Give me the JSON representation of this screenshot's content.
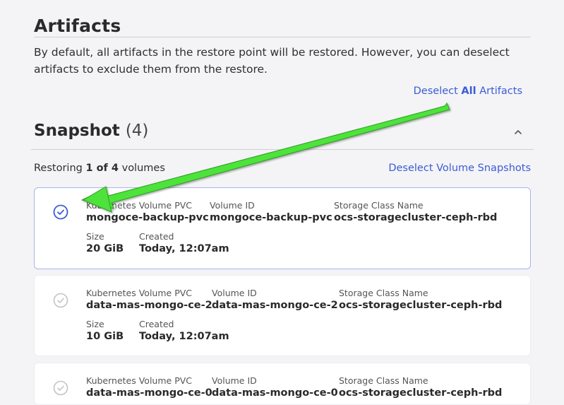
{
  "artifacts": {
    "title": "Artifacts",
    "description": "By default, all artifacts in the restore point will be restored. However, you can deselect artifacts to exclude them from the restore.",
    "deselect_prefix": "Deselect ",
    "deselect_bold": "All",
    "deselect_suffix": " Artifacts"
  },
  "snapshot": {
    "title": "Snapshot",
    "count": "(4)",
    "restoring_prefix": "Restoring ",
    "restoring_bold": "1 of 4",
    "restoring_suffix": " volumes",
    "deselect_label": "Deselect Volume Snapshots"
  },
  "labels": {
    "pvc": "Kubernetes Volume PVC",
    "volume_id": "Volume ID",
    "storage_class": "Storage Class Name",
    "size": "Size",
    "created": "Created"
  },
  "volumes": [
    {
      "pvc": "mongoce-backup-pvc",
      "volume_id": "mongoce-backup-pvc",
      "storage_class": "ocs-storagecluster-ceph-rbd",
      "size": "20 GiB",
      "created": "Today, 12:07am",
      "selected": true
    },
    {
      "pvc": "data-mas-mongo-ce-2",
      "volume_id": "data-mas-mongo-ce-2",
      "storage_class": "ocs-storagecluster-ceph-rbd",
      "size": "10 GiB",
      "created": "Today, 12:07am",
      "selected": false
    },
    {
      "pvc": "data-mas-mongo-ce-0",
      "volume_id": "data-mas-mongo-ce-0",
      "storage_class": "ocs-storagecluster-ceph-rbd",
      "selected": false
    }
  ],
  "colors": {
    "link": "#3b5bd6",
    "selected_check": "#3b5bd6",
    "unselected_check": "#b8b8be",
    "annotation_arrow": "#4ee33a"
  },
  "icons": {
    "check": "check-circle-icon",
    "collapse": "chevron-up-icon",
    "annotation": "annotation-arrow-icon"
  }
}
